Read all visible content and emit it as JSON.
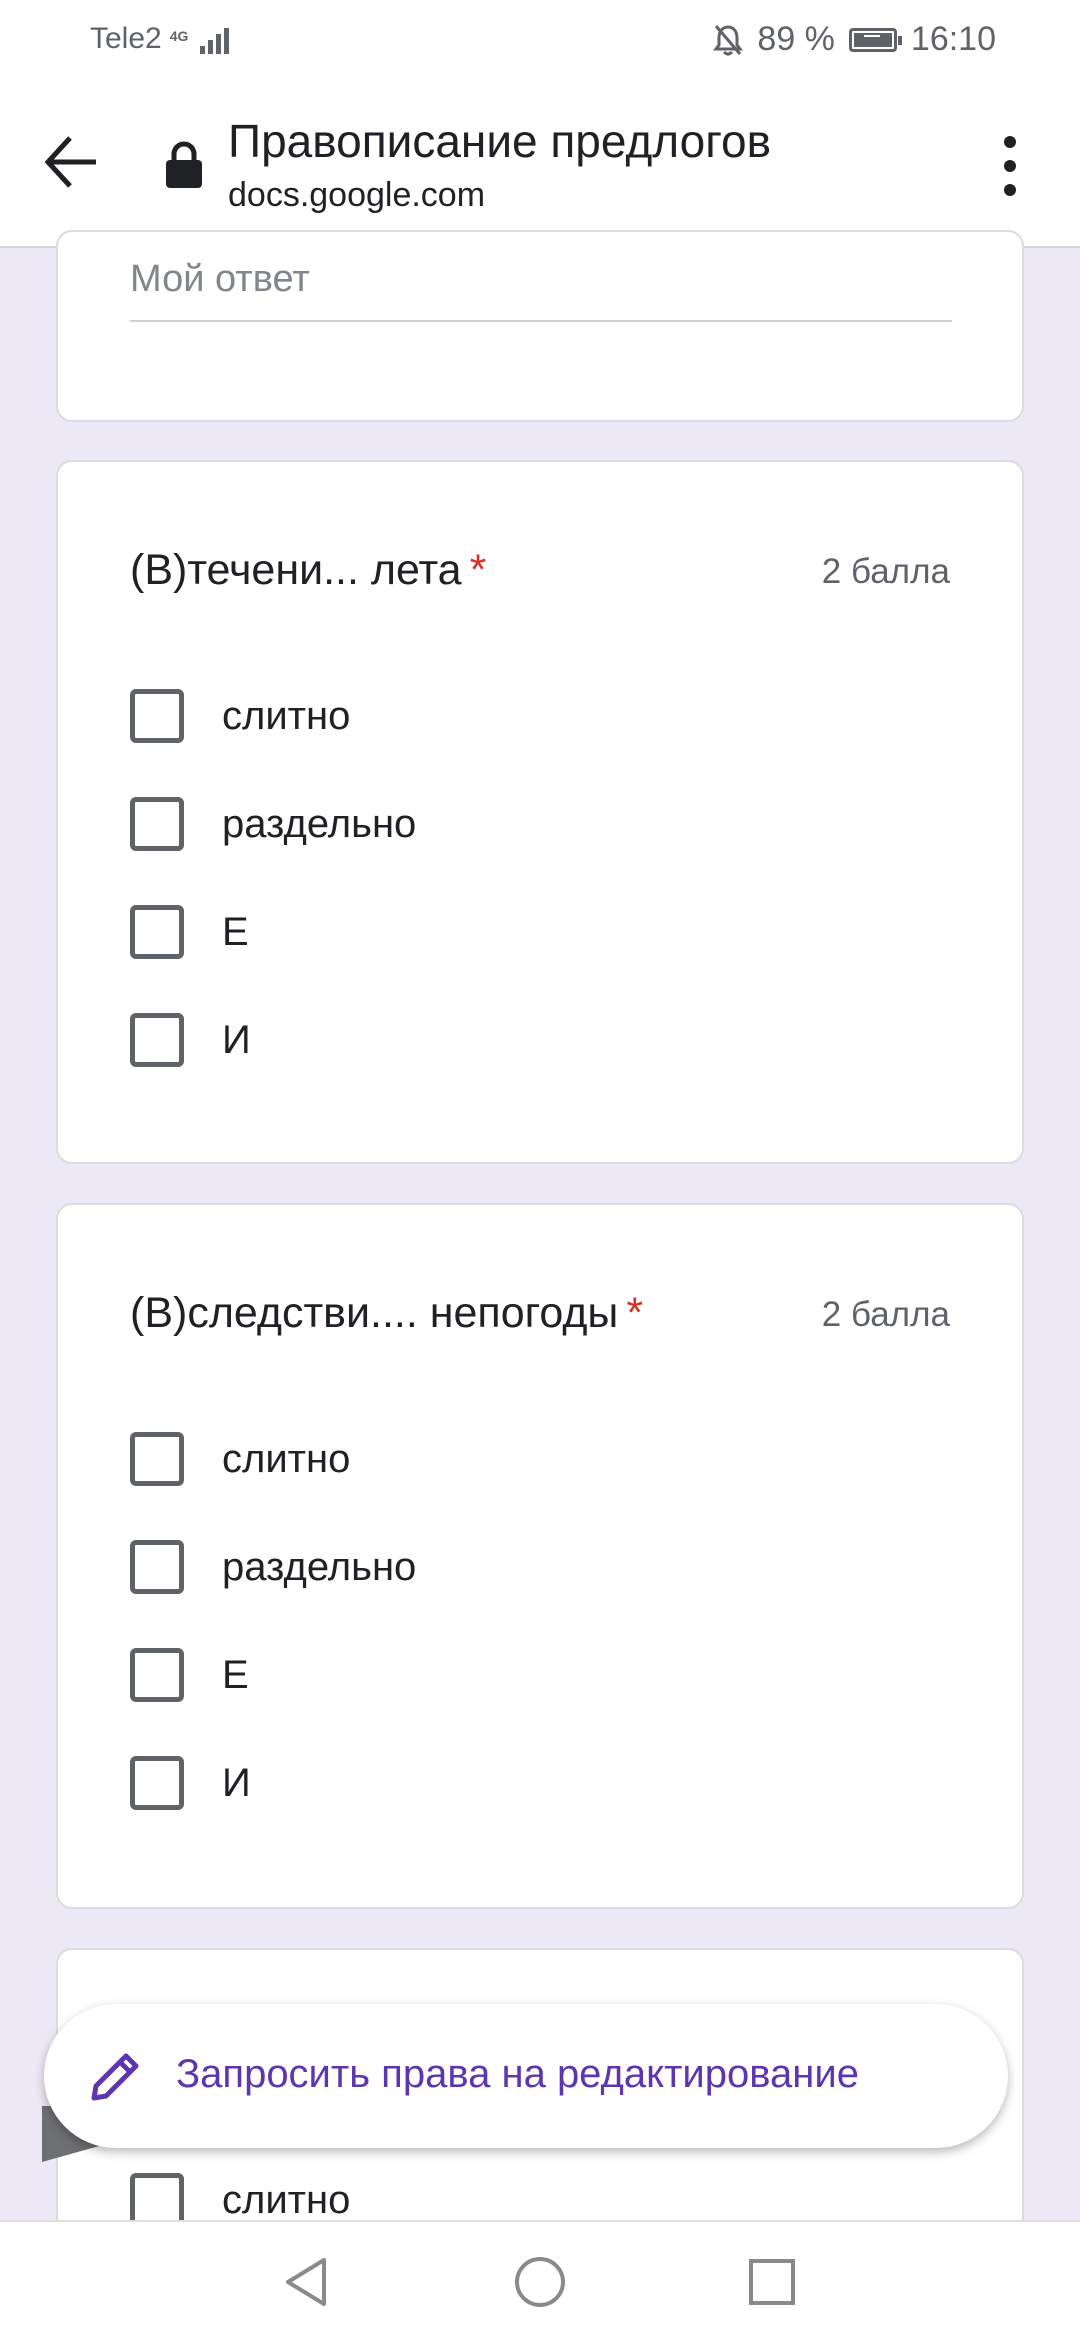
{
  "status_bar": {
    "carrier": "Tele2",
    "network": "4G",
    "battery_percent": "89 %",
    "time": "16:10"
  },
  "toolbar": {
    "title": "Правописание предлогов",
    "url": "docs.google.com"
  },
  "answer_card": {
    "placeholder": "Мой ответ"
  },
  "questions": [
    {
      "title": "(В)течени... лета",
      "required_mark": "*",
      "points": "2 балла",
      "options": [
        "слитно",
        "раздельно",
        "Е",
        "И"
      ]
    },
    {
      "title": "(В)следстви.... непогоды",
      "required_mark": "*",
      "points": "2 балла",
      "options": [
        "слитно",
        "раздельно",
        "Е",
        "И"
      ]
    },
    {
      "options": [
        "слитно"
      ]
    }
  ],
  "fab": {
    "label": "Запросить права на редактирование"
  },
  "colors": {
    "page_background": "#ede8f6",
    "accent": "#5e35b1",
    "required": "#d93025"
  }
}
